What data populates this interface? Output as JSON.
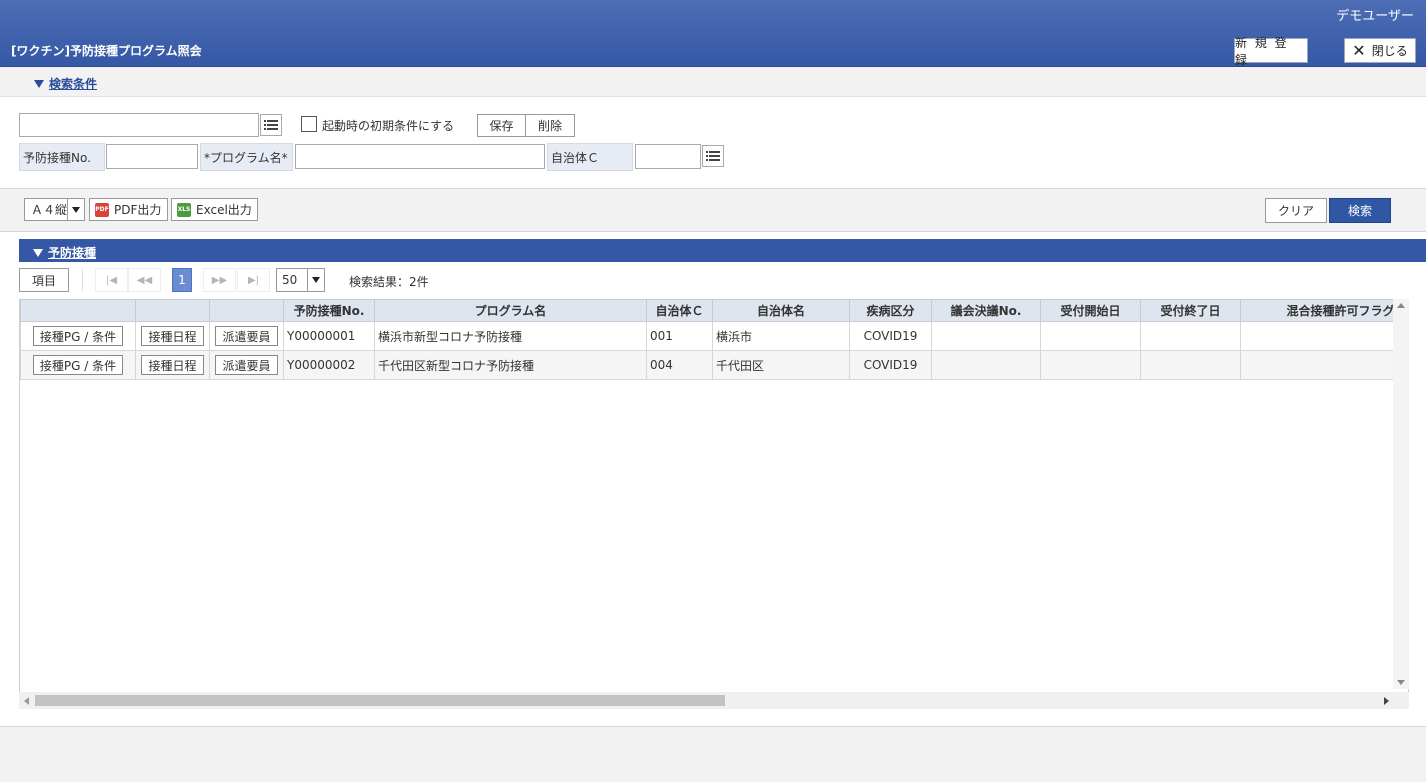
{
  "header": {
    "user": "デモユーザー",
    "title": "[ワクチン]予防接種プログラム照会",
    "new_label": "新 規 登 録",
    "close_label": "閉じる"
  },
  "conditions": {
    "section_label": "検索条件",
    "preset_value": "",
    "default_checkbox_label": "起動時の初期条件にする",
    "save_label": "保存",
    "delete_label": "削除",
    "fields": {
      "no_label": "予防接種No.",
      "no_value": "",
      "program_label": "*プログラム名*",
      "program_value": "",
      "municipality_label": "自治体Ｃ",
      "municipality_value": ""
    }
  },
  "toolbar": {
    "paper_size": "Ａ４縦",
    "pdf_label": "PDF出力",
    "excel_label": "Excel出力",
    "clear_label": "クリア",
    "search_label": "検索"
  },
  "results": {
    "section_label": "予防接種",
    "items_label": "項目",
    "current_page": "1",
    "page_size": "50",
    "count_text": "検索結果：2件",
    "columns": [
      "",
      "",
      "",
      "予防接種No.",
      "プログラム名",
      "自治体Ｃ",
      "自治体名",
      "疾病区分",
      "議会決議No.",
      "受付開始日",
      "受付終了日",
      "混合接種許可フラグ"
    ],
    "row_buttons": {
      "pg": "接種PG / 条件",
      "schedule": "接種日程",
      "staff": "派遣要員"
    },
    "rows": [
      {
        "no": "Y00000001",
        "program": "横浜市新型コロナ予防接種",
        "code": "001",
        "name": "横浜市",
        "disease": "COVID19",
        "resolution": "",
        "start": "",
        "end": "",
        "mixed": ""
      },
      {
        "no": "Y00000002",
        "program": "千代田区新型コロナ予防接種",
        "code": "004",
        "name": "千代田区",
        "disease": "COVID19",
        "resolution": "",
        "start": "",
        "end": "",
        "mixed": ""
      }
    ]
  },
  "colors": {
    "header_blue": "#3558a6",
    "search_button": "#2f57a4",
    "section_link": "#2a4d9b",
    "current_page": "#6a8cd2"
  },
  "icons": [
    "list-icon",
    "close-icon",
    "pdf-icon",
    "excel-icon",
    "first-page-icon",
    "prev-page-icon",
    "next-page-icon",
    "last-page-icon",
    "collapse-triangle-icon"
  ]
}
